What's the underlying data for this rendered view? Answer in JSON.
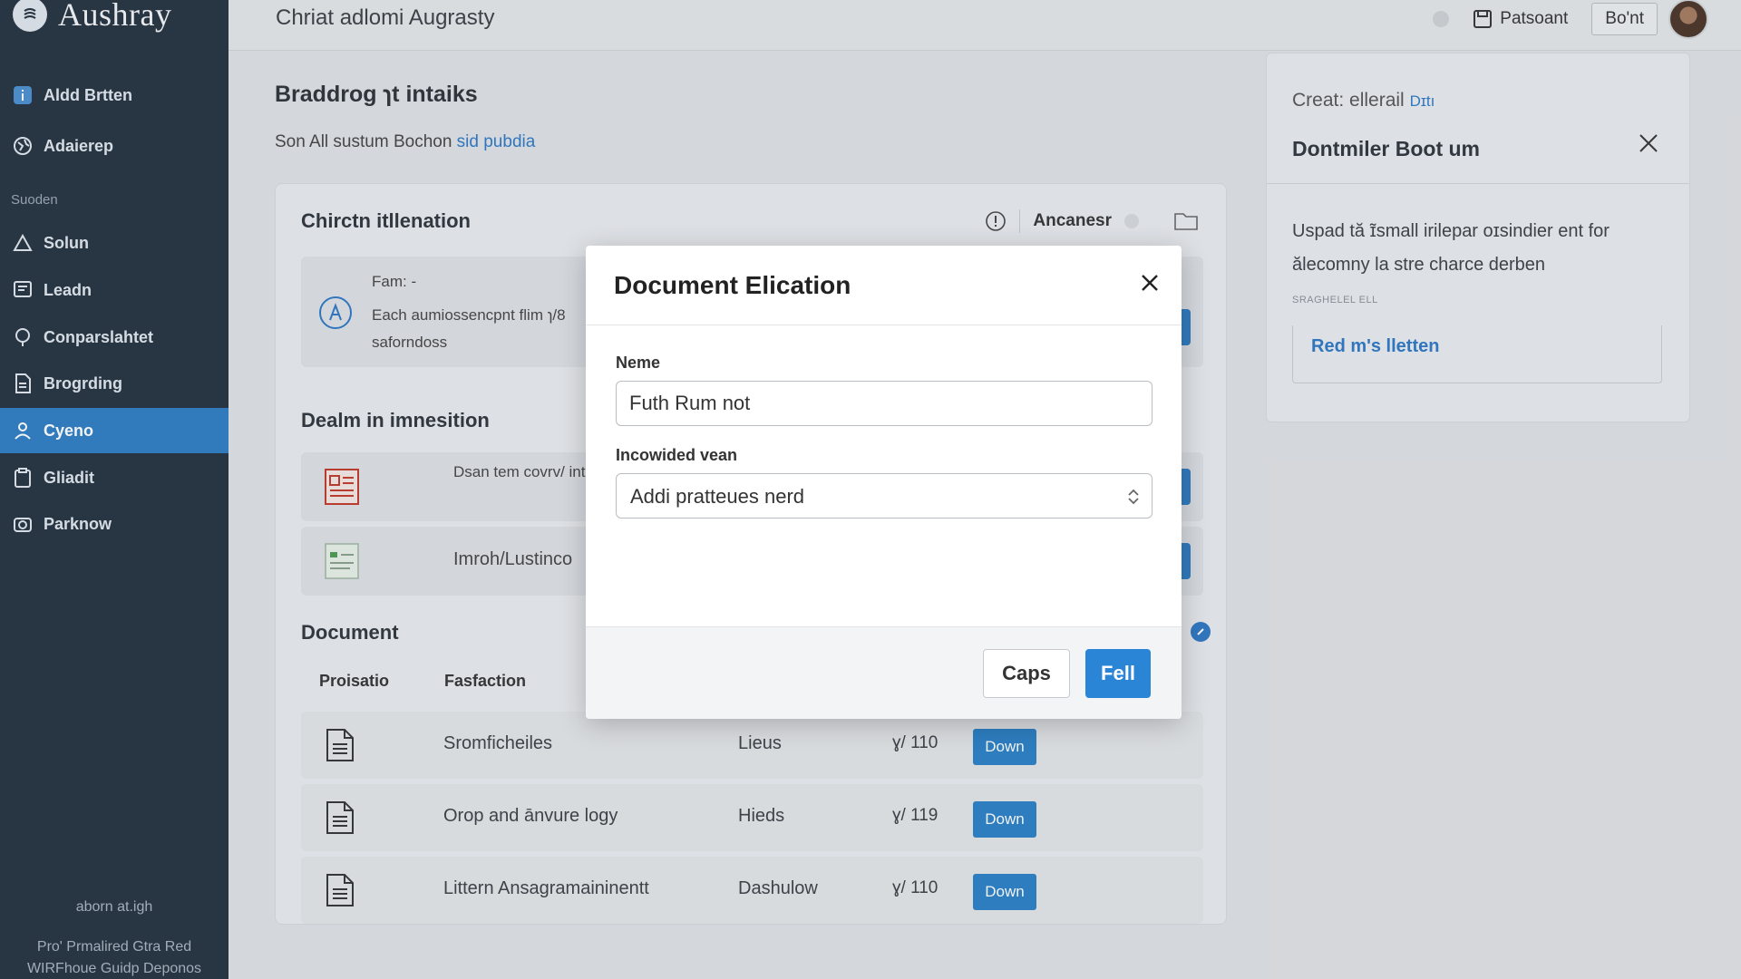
{
  "app": {
    "name": "Aushray",
    "window_title": "Chriat adlomi Augrasty"
  },
  "sidebar": {
    "items_top": [
      {
        "label": "Aldd Brtten",
        "icon": "info-icon"
      },
      {
        "label": "Adaierep",
        "icon": "globe-icon"
      }
    ],
    "section_label": "Suoden",
    "items": [
      {
        "label": "Solun",
        "icon": "triangle-icon"
      },
      {
        "label": "Leadn",
        "icon": "message-icon"
      },
      {
        "label": "Conparslahtet",
        "icon": "location-pin-icon"
      },
      {
        "label": "Brogrding",
        "icon": "document-icon"
      },
      {
        "label": "Cyeno",
        "icon": "person-icon",
        "active": true
      },
      {
        "label": "Gliadit",
        "icon": "clipboard-icon"
      },
      {
        "label": "Parknow",
        "icon": "camera-icon"
      }
    ],
    "footer": {
      "line1": "aborn at.igh",
      "line2": "Pro' Prmalired Gtra Red",
      "line3": "WIRFhoue Guidp Deponos"
    }
  },
  "topbar": {
    "link_label": "Patsoant",
    "button_label": "Bo'nt"
  },
  "main": {
    "title": "Braddrog ɿt intaiks",
    "subtitle_prefix": "Son All sustum Bochon",
    "subtitle_link": "sid pubdia",
    "card": {
      "heading": "Chirctn itllenation",
      "toggle_label": "Ancanesr",
      "info": {
        "label": "Fam: -",
        "text": "Each aumiossencpnt flim ɿ/8 saforndoss"
      },
      "section2_heading": "Dealm in imnesition",
      "rows": [
        {
          "text": "Dsan tem covrv/ int dowhemeer"
        },
        {
          "text": "Imroh/Lustinco"
        }
      ],
      "documents_heading": "Document",
      "columns": [
        "Proisatio",
        "Fasfaction"
      ],
      "documents": [
        {
          "name": "Sromficheiles",
          "type": "Lieus",
          "count": "ɣ/ 110",
          "button": "Down"
        },
        {
          "name": "Orop and ānvure logy",
          "type": "Hieds",
          "count": "ɣ/ 119",
          "button": "Down"
        },
        {
          "name": "Littern Ansagramaininentt",
          "type": "Dashulow",
          "count": "ɣ/ 110",
          "button": "Down"
        }
      ]
    }
  },
  "right_panel": {
    "create_label": "Creat: ellerail",
    "create_accent": "Dɪtı",
    "title": "Dontmiler Boot um",
    "text": "Uspad tă ɪ̃small irilepar oɪsindier ent for ălecomny la stre charce derben",
    "small_label": "SRAGHELEL ELL",
    "link": "Red m's lletten"
  },
  "modal": {
    "title": "Document Elication",
    "name_label": "Neme",
    "name_value": "Futh Rum not",
    "select_label": "Incowided vean",
    "select_value": "Addi pratteues nerd",
    "cancel_label": "Caps",
    "confirm_label": "Fell"
  },
  "colors": {
    "sidebar": "#24313f",
    "accent": "#2e7dc4",
    "primary_button": "#2a85d6"
  }
}
